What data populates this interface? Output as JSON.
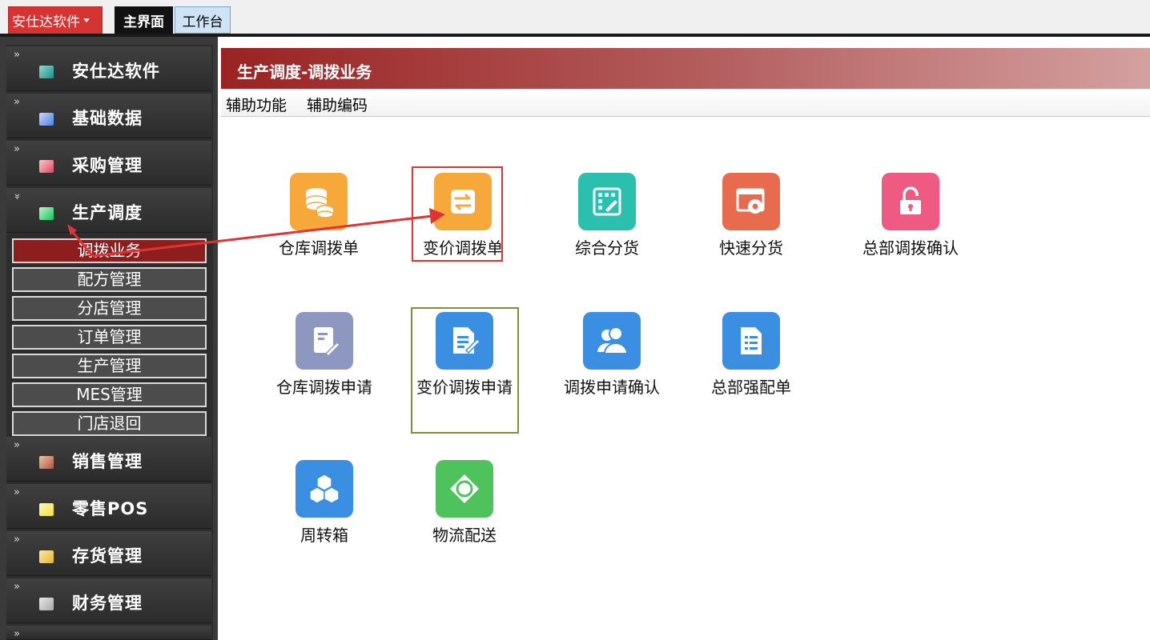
{
  "topbar": {
    "app_menu_label": "安仕达软件",
    "tabs": [
      {
        "label": "主界面",
        "active": true
      },
      {
        "label": "工作台",
        "active": false
      }
    ]
  },
  "sidebar": {
    "groups": [
      {
        "label": "安仕达软件",
        "icon": "teal-square-icon",
        "color": "#1c8f8a",
        "expanded": false,
        "chevron": "»"
      },
      {
        "label": "基础数据",
        "icon": "blue-square-icon",
        "color": "#4f7fe0",
        "expanded": false,
        "chevron": "»"
      },
      {
        "label": "采购管理",
        "icon": "red-square-icon",
        "color": "#e0455a",
        "expanded": false,
        "chevron": "»"
      },
      {
        "label": "生产调度",
        "icon": "green-square-icon",
        "color": "#19c25a",
        "expanded": true,
        "chevron": "»"
      },
      {
        "label": "销售管理",
        "icon": "brown-square-icon",
        "color": "#b0573a",
        "expanded": false,
        "chevron": "»"
      },
      {
        "label": "零售POS",
        "icon": "yellow-square-icon",
        "color": "#f2e03a",
        "expanded": false,
        "chevron": "»"
      },
      {
        "label": "存货管理",
        "icon": "gold-square-icon",
        "color": "#e8b52a",
        "expanded": false,
        "chevron": "»"
      },
      {
        "label": "财务管理",
        "icon": "grey-square-icon",
        "color": "#a8a8a8",
        "expanded": false,
        "chevron": "»"
      }
    ],
    "subitems": [
      {
        "label": "调拨业务",
        "active": true
      },
      {
        "label": "配方管理",
        "active": false
      },
      {
        "label": "分店管理",
        "active": false
      },
      {
        "label": "订单管理",
        "active": false
      },
      {
        "label": "生产管理",
        "active": false
      },
      {
        "label": "MES管理",
        "active": false
      },
      {
        "label": "门店退回",
        "active": false
      }
    ]
  },
  "main": {
    "title": "生产调度-调拨业务",
    "menu": [
      "辅助功能",
      "辅助编码"
    ],
    "tiles": [
      {
        "label": "仓库调拨单",
        "icon": "database-coins-icon",
        "color": "#f6a83a"
      },
      {
        "label": "变价调拨单",
        "icon": "swap-arrows-icon",
        "color": "#f6a83a"
      },
      {
        "label": "综合分货",
        "icon": "grid-edit-icon",
        "color": "#2bbfae"
      },
      {
        "label": "快速分货",
        "icon": "window-gear-icon",
        "color": "#e96b4d"
      },
      {
        "label": "总部调拨确认",
        "icon": "unlock-icon",
        "color": "#ef5a82"
      },
      {
        "label": "仓库调拨申请",
        "icon": "document-pen-icon",
        "color": "#8e97bf"
      },
      {
        "label": "变价调拨申请",
        "icon": "edit-document-icon",
        "color": "#3b8fe2"
      },
      {
        "label": "调拨申请确认",
        "icon": "users-icon",
        "color": "#3b8fe2"
      },
      {
        "label": "总部强配单",
        "icon": "checklist-icon",
        "color": "#3b8fe2"
      },
      {
        "label": "周转箱",
        "icon": "boxes-icon",
        "color": "#3b8fe2"
      },
      {
        "label": "物流配送",
        "icon": "recycle-icon",
        "color": "#4ec35c"
      }
    ]
  },
  "colors": {
    "accent_red": "#d63333",
    "annotation_red": "#e03434",
    "header_red": "#9a2222",
    "olive_outline": "#8a8a3c"
  }
}
